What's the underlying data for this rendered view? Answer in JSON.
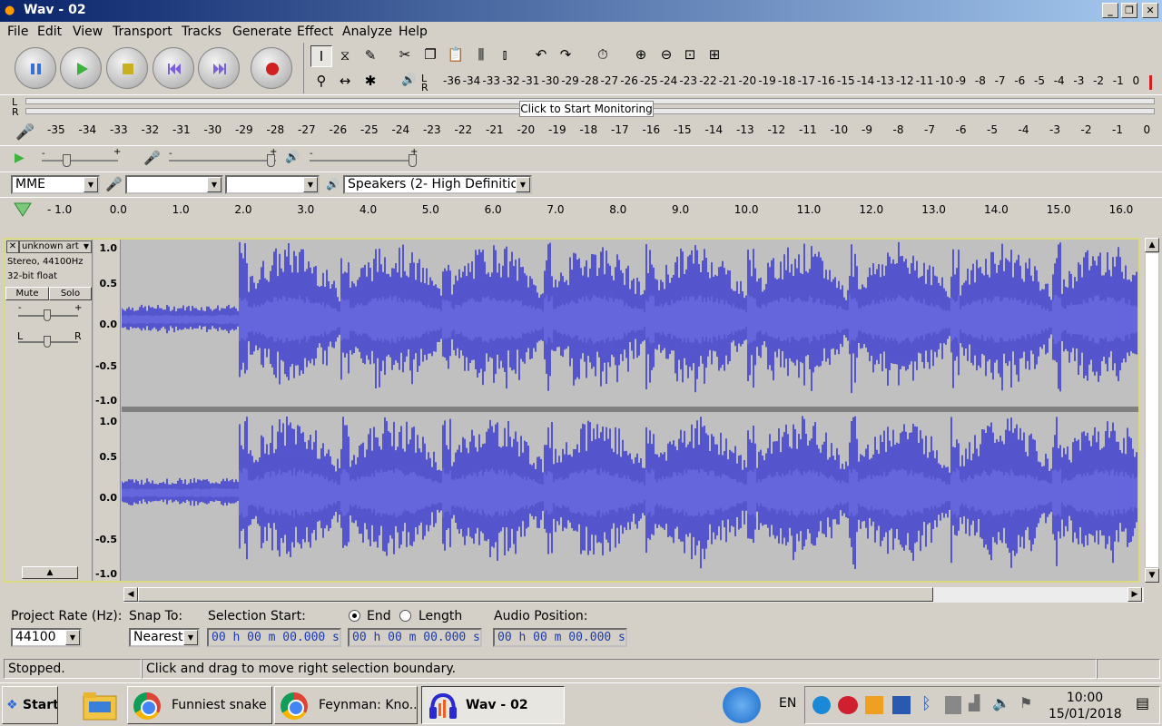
{
  "window": {
    "title": "Wav - 02",
    "min": "_",
    "max": "❐",
    "close": "✕"
  },
  "menu": [
    "File",
    "Edit",
    "View",
    "Transport",
    "Tracks",
    "Generate",
    "Effect",
    "Analyze",
    "Help"
  ],
  "meters": {
    "lr_top": [
      "L",
      "R"
    ],
    "lr_bottom": [
      "L",
      "R"
    ],
    "playback_ticks": [
      "-36",
      "-34",
      "-33",
      "-32",
      "-31",
      "-30",
      "-29",
      "-28",
      "-27",
      "-26",
      "-25",
      "-24",
      "-23",
      "-22",
      "-21",
      "-20",
      "-19",
      "-18",
      "-17",
      "-16",
      "-15",
      "-14",
      "-13",
      "-12",
      "-11",
      "-10",
      "-9",
      "-8",
      "-7",
      "-6",
      "-5",
      "-4",
      "-3",
      "-2",
      "-1",
      "0"
    ],
    "record_ticks": [
      "-35",
      "-34",
      "-33",
      "-32",
      "-31",
      "-30",
      "-29",
      "-28",
      "-27",
      "-26",
      "-25",
      "-24",
      "-23",
      "-22",
      "-21",
      "-20",
      "-19",
      "-18",
      "-17",
      "-16",
      "-15",
      "-14",
      "-13",
      "-12",
      "-11",
      "-10",
      "-9",
      "-8",
      "-7",
      "-6",
      "-5",
      "-4",
      "-3",
      "-2",
      "-1",
      "0"
    ],
    "monitor_label": "Click to Start Monitoring"
  },
  "mixer": {
    "minus": "-",
    "plus": "+",
    "minus2": "-",
    "plus2": "+",
    "minus3": "-",
    "plus3": "+"
  },
  "devices": {
    "host": "MME",
    "input": "",
    "channels": "",
    "output": "Speakers (2- High Definition Au"
  },
  "timeline": {
    "ticks": [
      "- 1.0",
      "0.0",
      "1.0",
      "2.0",
      "3.0",
      "4.0",
      "5.0",
      "6.0",
      "7.0",
      "8.0",
      "9.0",
      "10.0",
      "11.0",
      "12.0",
      "13.0",
      "14.0",
      "15.0",
      "16.0"
    ]
  },
  "track": {
    "name": "unknown art",
    "info1": "Stereo, 44100Hz",
    "info2": "32-bit float",
    "mute": "Mute",
    "solo": "Solo",
    "gain_minus": "-",
    "gain_plus": "+",
    "pan_left": "L",
    "pan_right": "R",
    "y_top": [
      "1.0",
      "0.5",
      "0.0",
      "-0.5",
      "-1.0"
    ],
    "y_bottom": [
      "1.0",
      "0.5",
      "0.0",
      "-0.5",
      "-1.0"
    ]
  },
  "selection": {
    "project_rate_label": "Project Rate (Hz):",
    "project_rate": "44100",
    "snap_label": "Snap To:",
    "snap": "Nearest",
    "start_label": "Selection Start:",
    "end_label": "End",
    "length_label": "Length",
    "position_label": "Audio Position:",
    "start": "00 h 00 m 00.000 s",
    "end": "00 h 00 m 00.000 s",
    "position": "00 h 00 m 00.000 s"
  },
  "status": {
    "state": "Stopped.",
    "hint": "Click and drag to move right selection boundary."
  },
  "taskbar": {
    "start": "Start",
    "items": [
      "Funniest snake ...",
      "Feynman: Kno...",
      "Wav - 02"
    ],
    "lang": "EN",
    "time": "10:00",
    "date": "15/01/2018"
  },
  "colors": {
    "wave": "#3a3ad0",
    "wave_rms": "#6464e0",
    "titlebar": "#0a246a"
  }
}
